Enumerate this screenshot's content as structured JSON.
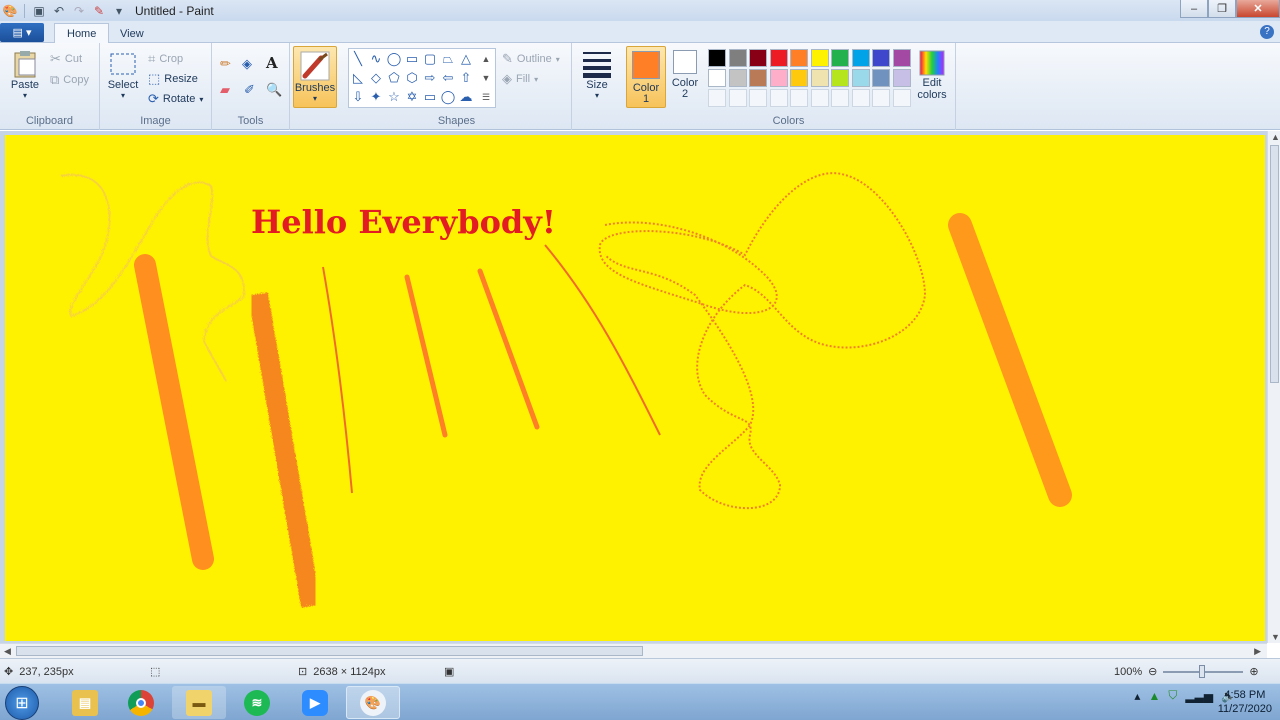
{
  "window": {
    "title": "Untitled - Paint"
  },
  "quick_access": {
    "save_icon": "save-icon",
    "undo_icon": "undo-icon",
    "redo_icon": "redo-icon",
    "customize_icon": "dropdown-icon"
  },
  "ribbon_tabs": [
    {
      "label": "Home"
    },
    {
      "label": "View"
    }
  ],
  "clipboard": {
    "paste": "Paste",
    "cut": "Cut",
    "copy": "Copy",
    "group_label": "Clipboard"
  },
  "image": {
    "select": "Select",
    "crop": "Crop",
    "resize": "Resize",
    "rotate": "Rotate",
    "group_label": "Image"
  },
  "tools": {
    "group_label": "Tools"
  },
  "brushes": {
    "label": "Brushes"
  },
  "shapes": {
    "outline": "Outline",
    "fill": "Fill",
    "group_label": "Shapes"
  },
  "size": {
    "label": "Size"
  },
  "colors": {
    "color1_label": "Color",
    "color1_num": "1",
    "color1_value": "#ff7f27",
    "color2_label": "Color",
    "color2_num": "2",
    "color2_value": "#ffffff",
    "edit_label": "Edit",
    "edit_label2": "colors",
    "group_label": "Colors",
    "palette_row1": [
      "#000000",
      "#7f7f7f",
      "#880015",
      "#ed1c24",
      "#ff7f27",
      "#fff200",
      "#22b14c",
      "#00a2e8",
      "#3f48cc",
      "#a349a4"
    ],
    "palette_row2": [
      "#ffffff",
      "#c3c3c3",
      "#b97a57",
      "#ffaec9",
      "#ffc90e",
      "#efe4b0",
      "#b5e61d",
      "#99d9ea",
      "#7092be",
      "#c8bfe7"
    ]
  },
  "canvas": {
    "background": "#fff200",
    "text": "Hello Everybody!",
    "text_color": "#e31b23"
  },
  "status": {
    "cursor_pos": "237, 235px",
    "image_size": "2638 × 1124px",
    "zoom": "100%"
  },
  "taskbar": {
    "apps": [
      "file-explorer-icon",
      "chrome-icon",
      "folder-icon",
      "spotify-icon",
      "zoom-icon",
      "paint-icon"
    ],
    "time": "4:58 PM",
    "date": "11/27/2020"
  }
}
